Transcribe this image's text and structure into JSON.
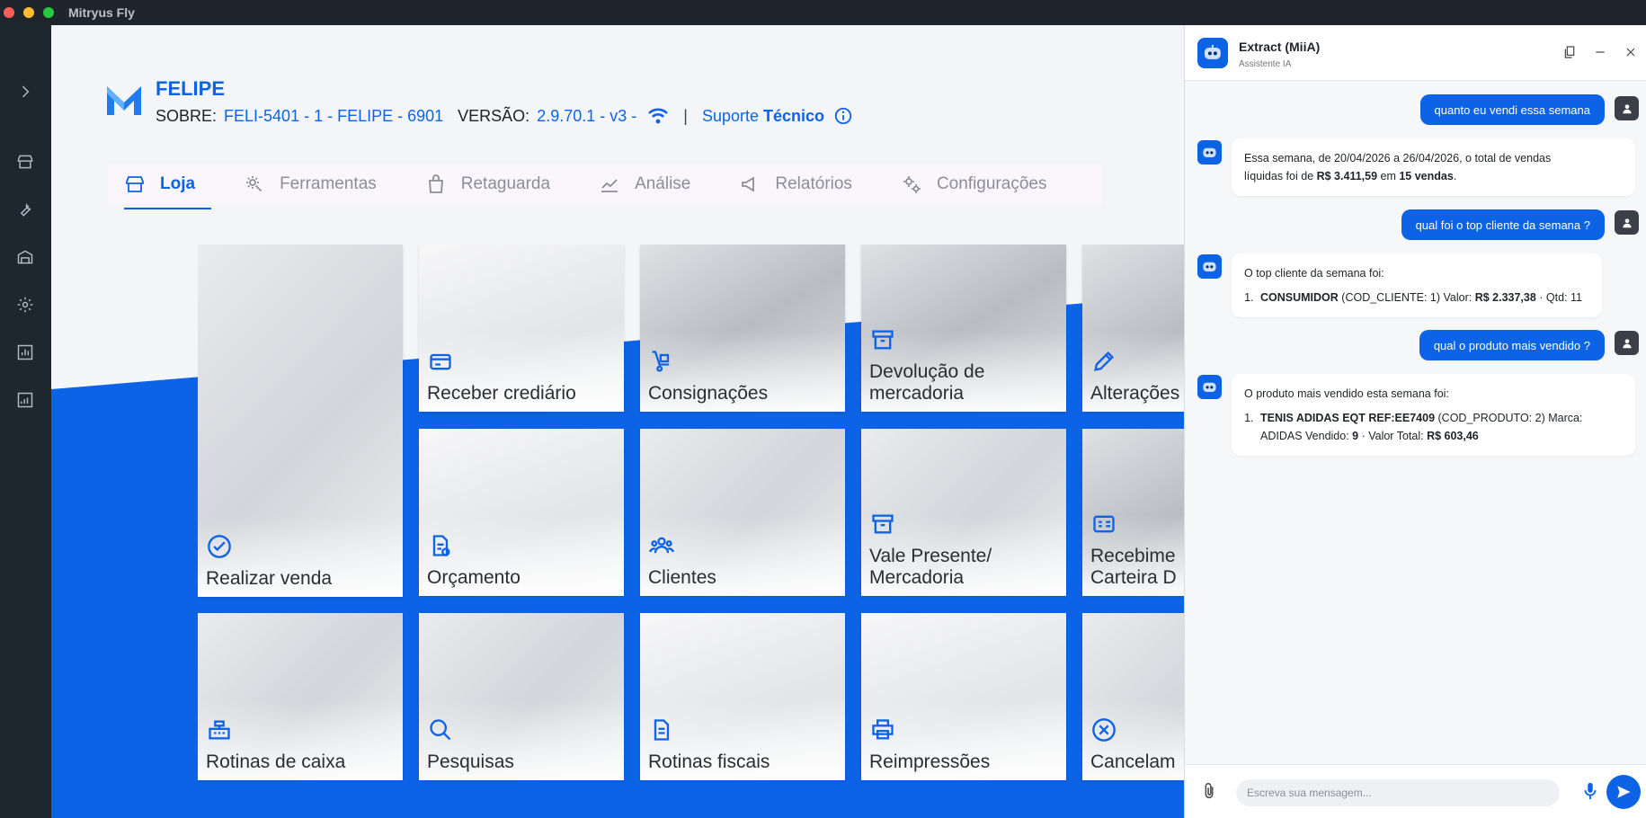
{
  "window": {
    "title": "Mitryus Fly"
  },
  "store": {
    "name": "FELIPE",
    "sobre_label": "SOBRE:",
    "sobre_value": "FELI-5401 - 1 - FELIPE - 6901",
    "versao_label": "VERSÃO:",
    "versao_value": "2.9.70.1 - v3 -",
    "separator": "|",
    "suporte_prefix": "Suporte",
    "suporte_bold": "Técnico"
  },
  "tabs": [
    {
      "label": "Loja",
      "icon": "store-icon",
      "active": true
    },
    {
      "label": "Ferramentas",
      "icon": "tools-gear-icon",
      "active": false
    },
    {
      "label": "Retaguarda",
      "icon": "warehouse-icon",
      "active": false
    },
    {
      "label": "Análise",
      "icon": "line-chart-icon",
      "active": false
    },
    {
      "label": "Relatórios",
      "icon": "megaphone-icon",
      "active": false
    },
    {
      "label": "Configurações",
      "icon": "gears-icon",
      "active": false
    }
  ],
  "tiles": [
    {
      "label": "Realizar venda",
      "icon": "check-circle-icon"
    },
    {
      "label": "Receber crediário",
      "icon": "credit-card-icon"
    },
    {
      "label": "Consignações",
      "icon": "hand-truck-icon"
    },
    {
      "label": "Devolução de",
      "label2": "mercadoria",
      "icon": "archive-box-icon"
    },
    {
      "label": "Alterações",
      "icon": "pencil-icon"
    },
    {
      "label": "Orçamento",
      "icon": "document-dollar-icon"
    },
    {
      "label": "Clientes",
      "icon": "users-icon"
    },
    {
      "label": "Vale Presente/",
      "label2": "Mercadoria",
      "icon": "archive-box-icon"
    },
    {
      "label": "Recebime",
      "label2": "Carteira D",
      "icon": "money-card-icon"
    },
    {
      "label": "Rotinas de caixa",
      "icon": "cash-register-icon"
    },
    {
      "label": "Pesquisas",
      "icon": "search-icon"
    },
    {
      "label": "Rotinas fiscais",
      "icon": "document-icon"
    },
    {
      "label": "Reimpressões",
      "icon": "printer-icon"
    },
    {
      "label": "Cancelam",
      "icon": "cancel-circle-icon"
    }
  ],
  "chat": {
    "title": "Extract (MiiA)",
    "subtitle": "Assistente IA",
    "messages": {
      "u1": "quanto eu vendi essa semana",
      "b1_a": "Essa semana, de 20/04/2026 a 26/04/2026, o total de vendas",
      "b1_b": "líquidas foi de ",
      "b1_amount": "R$ 3.411,59",
      "b1_c": " em ",
      "b1_count": "15 vendas",
      "b1_d": ".",
      "u2": "qual foi o top cliente da semana ?",
      "b2_intro": "O top cliente da semana foi:",
      "b2_name": "CONSUMIDOR",
      "b2_mid": " (COD_CLIENTE: 1) Valor: ",
      "b2_value": "R$ 2.337,38",
      "b2_end": " · Qtd: 11",
      "u3": "qual o produto mais vendido ?",
      "b3_intro": "O produto mais vendido esta semana foi:",
      "b3_name": "TENIS ADIDAS EQT REF:EE7409",
      "b3_mid": " (COD_PRODUTO: 2) Marca:",
      "b3_line2a": "ADIDAS Vendido: ",
      "b3_qty": "9",
      "b3_line2b": " · Valor Total: ",
      "b3_total": "R$ 603,46"
    },
    "input_placeholder": "Escreva sua mensagem..."
  },
  "colors": {
    "brand_blue": "#0d63e6",
    "sidebar": "#1e2630",
    "background": "#f4f5f8"
  }
}
